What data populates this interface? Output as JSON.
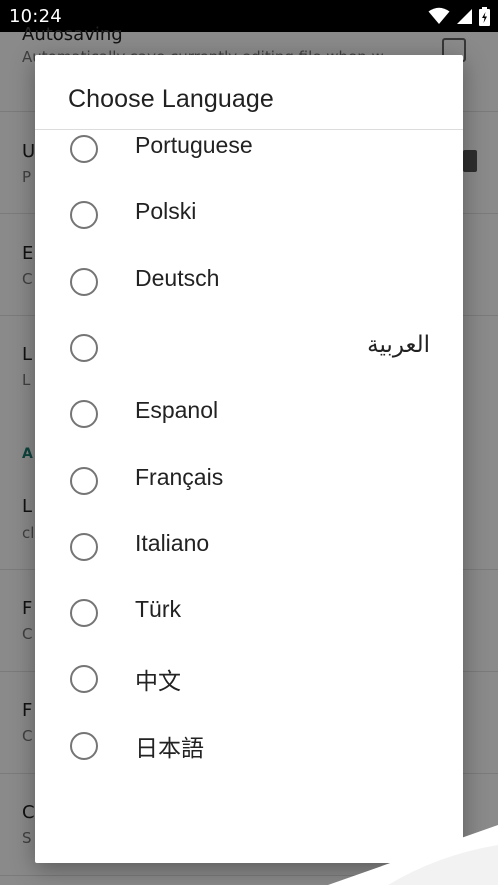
{
  "status_bar": {
    "time": "10:24",
    "icons": [
      "wifi-icon",
      "cell-signal-icon",
      "battery-icon"
    ]
  },
  "background_screen": {
    "items": [
      {
        "title": "Autosaving",
        "subtitle": "Automatically save currently editing file when w"
      },
      {
        "title": "U",
        "subtitle": "P"
      },
      {
        "title": "E",
        "subtitle": "C"
      },
      {
        "title": "L",
        "subtitle": "L"
      },
      {
        "section": "A"
      },
      {
        "title": "L",
        "subtitle": "cl"
      },
      {
        "title": "F",
        "subtitle": "C"
      },
      {
        "title": "F",
        "subtitle": "C"
      },
      {
        "title": "C",
        "subtitle": "S"
      }
    ]
  },
  "dialog": {
    "title": "Choose Language",
    "options": [
      {
        "label": "Portuguese",
        "selected": false
      },
      {
        "label": "Polski",
        "selected": false
      },
      {
        "label": "Deutsch",
        "selected": false
      },
      {
        "label": "العربية",
        "selected": false,
        "rtl": true
      },
      {
        "label": "Espanol",
        "selected": false
      },
      {
        "label": "Français",
        "selected": false
      },
      {
        "label": "Italiano",
        "selected": false
      },
      {
        "label": "Türk",
        "selected": false
      },
      {
        "label": "中文",
        "selected": false
      },
      {
        "label": "日本語",
        "selected": false
      }
    ]
  },
  "colors": {
    "accent": "#1a7f74",
    "radio_border": "#757575",
    "scrim": "#00000075"
  }
}
